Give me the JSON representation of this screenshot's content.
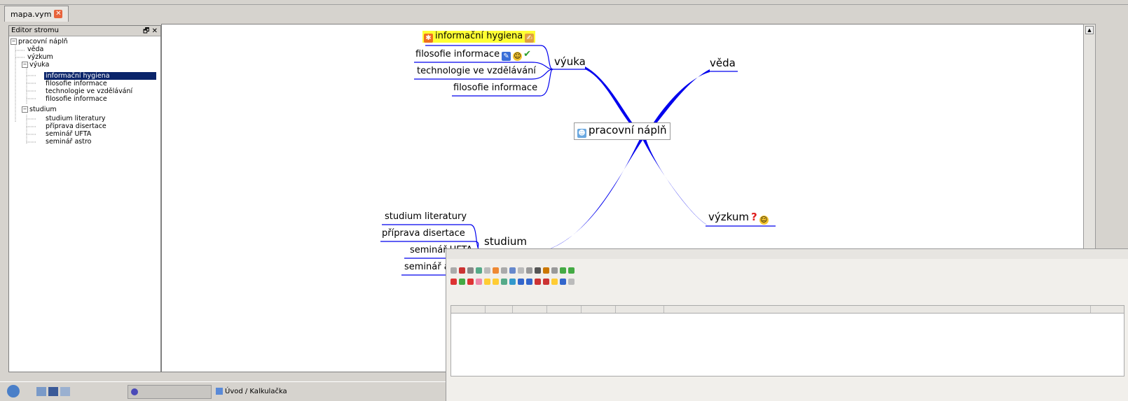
{
  "tabs": [
    {
      "label": "mapa.vym"
    }
  ],
  "tree_panel": {
    "title": "Editor stromu",
    "buttons": "🗗 ✕",
    "items": [
      {
        "label": "pracovní náplň",
        "level": 0,
        "expander": "−"
      },
      {
        "label": "věda",
        "level": 1
      },
      {
        "label": "výzkum",
        "level": 1
      },
      {
        "label": "výuka",
        "level": 1,
        "expander": "−"
      },
      {
        "label": "informační hygiena",
        "level": 2,
        "selected": true
      },
      {
        "label": "filosofie informace",
        "level": 2
      },
      {
        "label": "technologie ve vzdělávání",
        "level": 2
      },
      {
        "label": "filosofie informace",
        "level": 2
      },
      {
        "label": "studium",
        "level": 1,
        "expander": "−"
      },
      {
        "label": "studium literatury",
        "level": 2
      },
      {
        "label": "příprava disertace",
        "level": 2
      },
      {
        "label": "seminář UFTA",
        "level": 2
      },
      {
        "label": "seminář astro",
        "level": 2
      }
    ]
  },
  "map": {
    "center": "pracovní náplň",
    "nodes": {
      "vyuka": "výuka",
      "veda": "věda",
      "vyzkum": "výzkum",
      "studium": "studium",
      "hygiena": "informační hygiena",
      "filosofie1": "filosofie informace",
      "technologie": "technologie ve vzdělávání",
      "filosofie2": "filosofie informace",
      "literatura": "studium literatury",
      "disertace": "příprava disertace",
      "ufta": "seminář UFTA",
      "astro": "seminář a"
    },
    "branch_color": "#0000ee",
    "highlight_color": "#ffff33"
  },
  "taskbar": {
    "window_label": "Úvod / Kalkulačka"
  }
}
